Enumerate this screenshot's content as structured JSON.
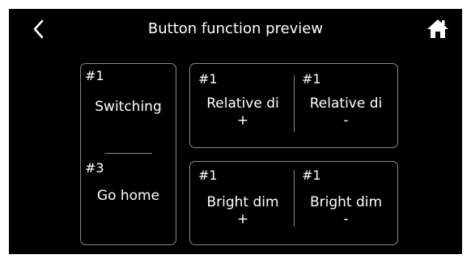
{
  "header": {
    "title": "Button function preview",
    "back_icon": "chevron-left-icon",
    "home_icon": "home-icon"
  },
  "left_panel": {
    "top": {
      "number": "#1",
      "label": "Switching"
    },
    "bottom": {
      "number": "#3",
      "label": "Go home"
    }
  },
  "relative_panel": {
    "left": {
      "number": "#1",
      "label": "Relative di",
      "sign": "+"
    },
    "right": {
      "number": "#1",
      "label": "Relative di",
      "sign": "-"
    }
  },
  "bright_panel": {
    "left": {
      "number": "#1",
      "label": "Bright dim",
      "sign": "+"
    },
    "right": {
      "number": "#1",
      "label": "Bright dim",
      "sign": "-"
    }
  },
  "colors": {
    "background": "#000000",
    "text": "#ffffff",
    "border": "#8a8a8a"
  }
}
